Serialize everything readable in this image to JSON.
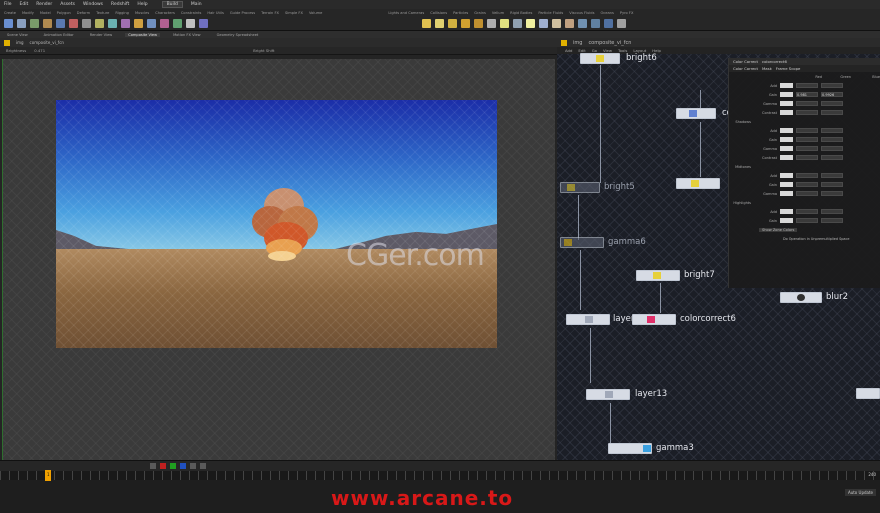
{
  "menubar": {
    "items": [
      "File",
      "Edit",
      "Render",
      "Assets",
      "Windows",
      "Redshift",
      "Help"
    ],
    "build": "Build",
    "desktop": "Main"
  },
  "shelf": {
    "tabs": [
      "Create",
      "Modify",
      "Model",
      "Polygon",
      "Deform",
      "Texture",
      "Rigging",
      "Muscles",
      "Characters",
      "Constraints",
      "Hair Utils",
      "Guide Process",
      "Terrain FX",
      "Simple FX",
      "Volume"
    ],
    "right_tabs": [
      "Lights and Cameras",
      "Collisions",
      "Particles",
      "Grains",
      "Vellum",
      "Rigid Bodies",
      "Particle Fluids",
      "Viscous Fluids",
      "Oceans",
      "Pyro FX",
      "FEM",
      "Wires",
      "Crowds",
      "Drive Simulation"
    ]
  },
  "pane_tabs": [
    "Scene View",
    "Animation Editor",
    "Render View",
    "Composite View",
    "Motion FX View",
    "Geometry Spreadsheet"
  ],
  "viewer": {
    "path": [
      "img",
      "composite_vi_fcn"
    ],
    "param_label": "Brightness",
    "param_value": "0.471",
    "right_label": "Bright Shift"
  },
  "watermark": "CGer.com",
  "network": {
    "path": [
      "img",
      "composite_vi_fcn"
    ],
    "menu": [
      "Add",
      "Edit",
      "Go",
      "View",
      "Tools",
      "Layout",
      "Help"
    ],
    "nodes": [
      {
        "label": "bright6"
      },
      {
        "label": "colorcorrect7"
      },
      {
        "label": "bright5"
      },
      {
        "label": "gamma6"
      },
      {
        "label": "bright7"
      },
      {
        "label": "layer14"
      },
      {
        "label": "colorcorrect6"
      },
      {
        "label": "blur2"
      },
      {
        "label": "layer13"
      },
      {
        "label": "gamma3"
      }
    ]
  },
  "param_panel": {
    "title": "Color Correct",
    "node_name": "colorcorrect6",
    "tabs": [
      "Color Correct",
      "Mask",
      "Frame Scope"
    ],
    "columns": [
      "Red",
      "Green",
      "Blue"
    ],
    "sections": [
      "Shadows",
      "Midtones",
      "Highlights"
    ],
    "rows": [
      "Add",
      "Gain",
      "Gamma",
      "Contrast"
    ],
    "gain_values": [
      "0.981",
      "0.9926"
    ],
    "options": [
      "Show Zone Colors",
      "Do Operation in Unpremultiplied Space"
    ]
  },
  "timeline": {
    "frame": "1",
    "end": "240"
  },
  "footer": {
    "brand": "www.arcane.to",
    "auto_update": "Auto Update"
  },
  "colors": {
    "accent": "#f0a000",
    "node_bg": "#d6dbe4",
    "network_bg": "#1b1e26",
    "brand_red": "#d81818"
  }
}
